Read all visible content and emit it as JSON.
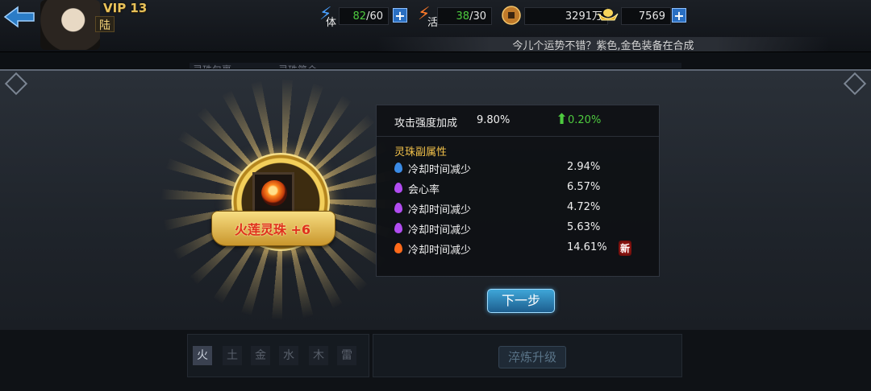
{
  "header": {
    "vip": "VIP 13",
    "player_name": "陆",
    "stamina": {
      "label": "体",
      "current": "82",
      "max": "/60"
    },
    "vigor": {
      "label": "活",
      "current": "38",
      "max": "/30"
    },
    "coins": "3291万",
    "gold": "7569",
    "ticker": "今儿个运势不错？紫色,金色装备在合成"
  },
  "background_page": {
    "left_label": "灵珠包裹",
    "right_label": "灵珠简介"
  },
  "reward": {
    "item_name": "火莲灵珠 +6",
    "main_stat": {
      "label": "攻击强度加成",
      "value": "9.80%",
      "delta": "0.20%"
    },
    "sub_title": "灵珠副属性",
    "sub_stats": [
      {
        "name": "冷却时间减少",
        "value": "2.94%",
        "quality": "blue"
      },
      {
        "name": "会心率",
        "value": "6.57%",
        "quality": "purple"
      },
      {
        "name": "冷却时间减少",
        "value": "4.72%",
        "quality": "purple"
      },
      {
        "name": "冷却时间减少",
        "value": "5.63%",
        "quality": "purple"
      },
      {
        "name": "冷却时间减少",
        "value": "14.61%",
        "quality": "orange",
        "badge": "新"
      }
    ],
    "next_button": "下一步"
  },
  "elements": [
    "火",
    "土",
    "金",
    "水",
    "木",
    "雷"
  ],
  "refine_button": "淬炼升级",
  "colors": {
    "blue": "#3a8be6",
    "purple": "#b14cf0",
    "orange": "#ff6a1a",
    "green": "#4ecb3f",
    "gold": "#f2c14a"
  }
}
